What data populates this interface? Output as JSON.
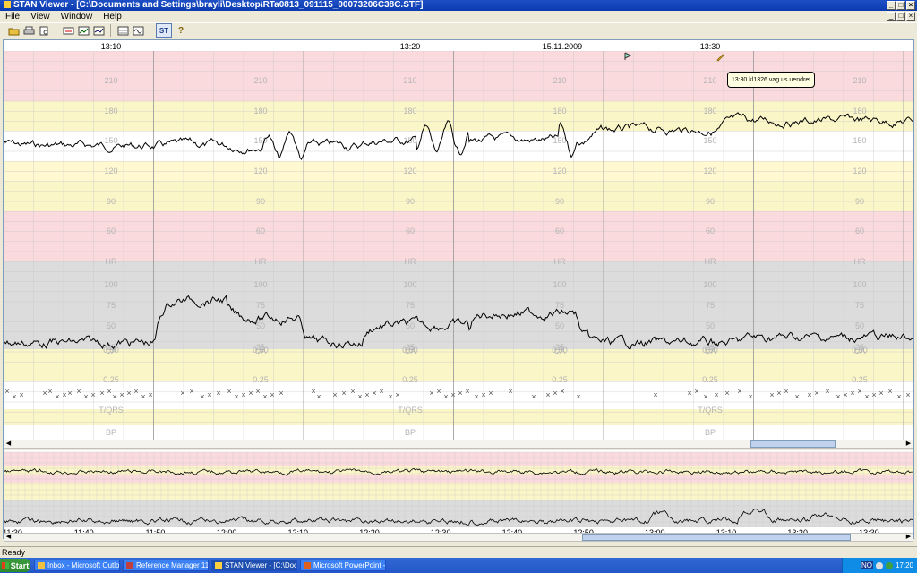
{
  "window": {
    "title": "STAN Viewer - [C:\\Documents and Settings\\brayli\\Desktop\\RTa0813_091115_00073206C38C.STF]"
  },
  "menu": [
    "File",
    "View",
    "Window",
    "Help"
  ],
  "toolbar": {
    "buttons": [
      "open-icon",
      "print-icon",
      "print-preview-icon",
      "event-icon",
      "trend-icon",
      "trend2-icon",
      "zoom-icon",
      "wave-icon",
      "st-button",
      "help-icon"
    ],
    "st_label": "ST"
  },
  "main": {
    "date": "15.11.2009",
    "top_times": [
      "13:10",
      "13:20",
      "13:30"
    ],
    "hr_labels": [
      "210",
      "180",
      "150",
      "120",
      "90",
      "60"
    ],
    "ua_labels": [
      "100",
      "75",
      "50",
      "25"
    ],
    "ua_sub": [
      "0.50",
      "0.25"
    ],
    "row_labels": {
      "hr": "HR",
      "ua": "UA",
      "tqrs": "T/QRS",
      "bp": "BP"
    },
    "note": "13:30 kl1326 vag us uendret",
    "colors": {
      "red_band": "#fadadd",
      "yellow_band": "#fbf6c8",
      "gray_band": "#dcdcdc",
      "grid": "#b4b4b4",
      "trace": "#000000",
      "labels": "#b4b4b4"
    }
  },
  "overview": {
    "times": [
      "11:30",
      "11:40",
      "11:50",
      "12:00",
      "12:10",
      "12:20",
      "12:30",
      "12:40",
      "12:50",
      "13:00",
      "13:10",
      "13:20",
      "13:30"
    ]
  },
  "status": {
    "text": "Ready"
  },
  "taskbar": {
    "start": "Start",
    "tasks": [
      "Inbox - Microsoft Outlook",
      "Reference Manager 11 - ...",
      "STAN Viewer - [C:\\Doc...",
      "Microsoft PowerPoint - [..."
    ],
    "active": 2,
    "tray_lang": "NO",
    "clock": "17:20"
  }
}
